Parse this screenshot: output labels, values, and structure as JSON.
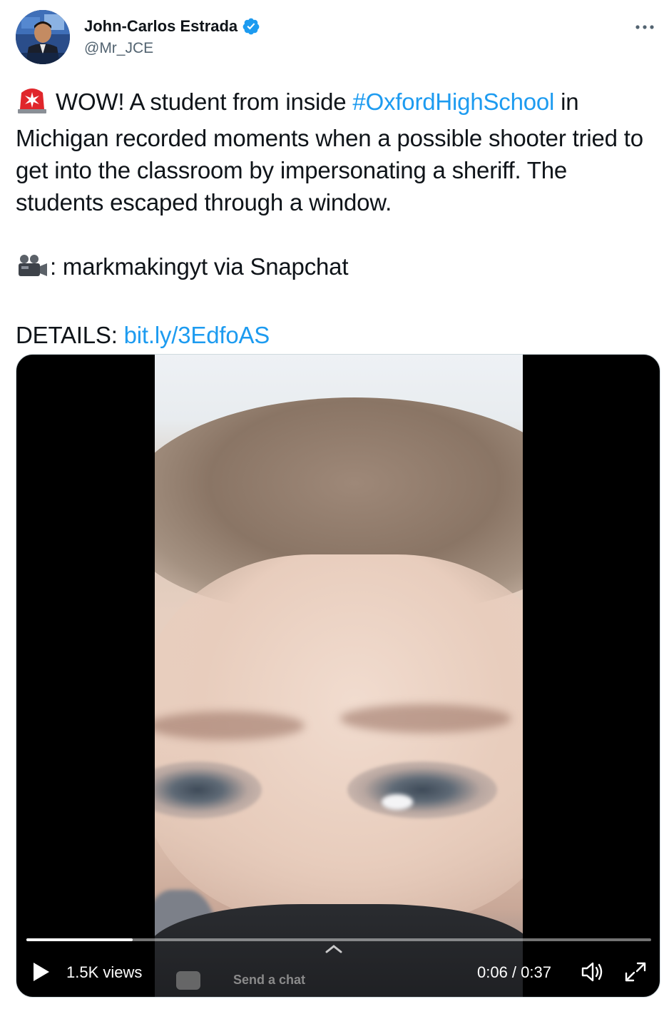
{
  "author": {
    "name": "John-Carlos Estrada",
    "handle": "@Mr_JCE",
    "verified": true,
    "avatar_icon": "avatar-photo"
  },
  "tweet": {
    "line1_pre": "WOW! A student from inside ",
    "hashtag": "#OxfordHighSchool",
    "line1_post": " in Michigan recorded moments when a possible shooter tried to get into the classroom by impersonating a sheriff. The students escaped through a window.",
    "credit": ": markmakingyt via Snapchat",
    "details_label": "DETAILS: ",
    "details_link": "bit.ly/3EdfoAS",
    "emoji_alert": "rotating-light-icon",
    "emoji_camera": "video-camera-icon"
  },
  "video": {
    "views": "1.5K views",
    "time": "0:06 / 0:37",
    "progress": 0.17,
    "overlay_chat": "Send a chat"
  },
  "colors": {
    "link": "#1d9bf0",
    "text": "#0f1419",
    "muted": "#536471",
    "verified": "#1d9bf0"
  }
}
